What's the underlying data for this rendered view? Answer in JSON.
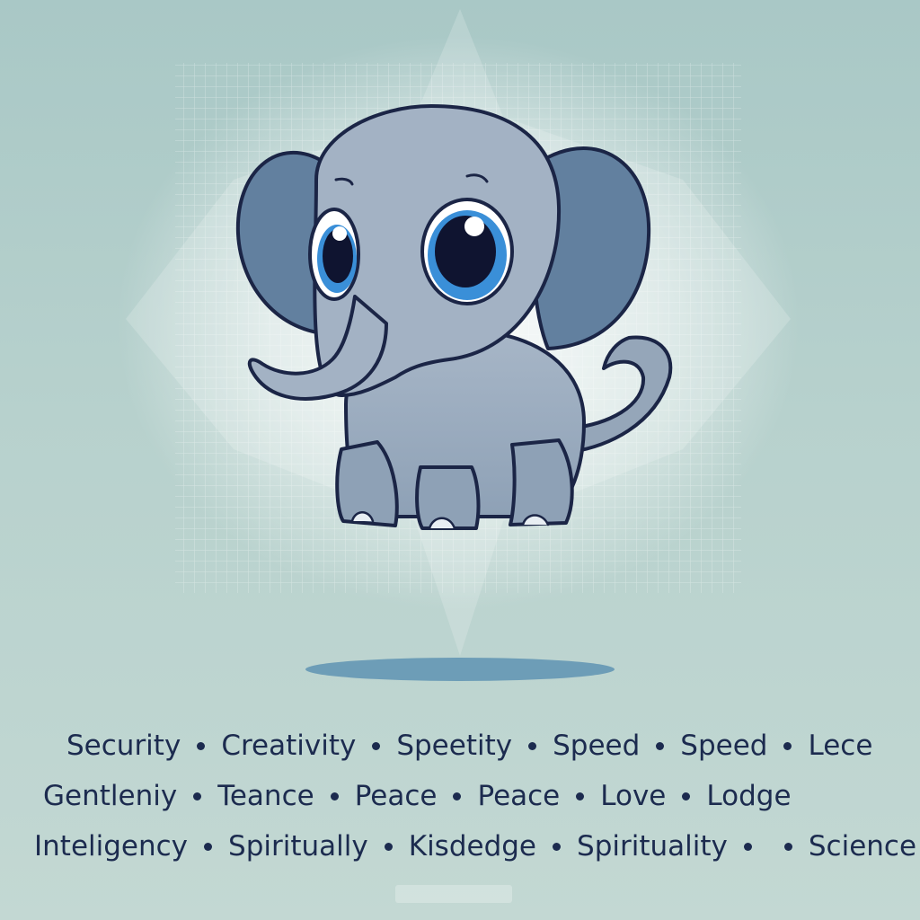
{
  "illustration": {
    "subject": "elephant-icon",
    "colors": {
      "background": "#b0cdca",
      "body": "#9aabbe",
      "ear_inner": "#62809f",
      "outline": "#1b2546",
      "eye_iris": "#3a8fd8",
      "shadow": "#5f93b3"
    }
  },
  "keywords": {
    "line1": [
      "Security",
      "Creativity",
      "Speetity",
      "Speed",
      "Speed",
      "Lece"
    ],
    "line2": [
      "Gentleniy",
      "Teance",
      "Peace",
      "Peace",
      "Love",
      "Lodge"
    ],
    "line3": [
      "Inteligency",
      "Spiritually",
      "Kisdedge",
      "Spirituality",
      "",
      "Science"
    ]
  }
}
